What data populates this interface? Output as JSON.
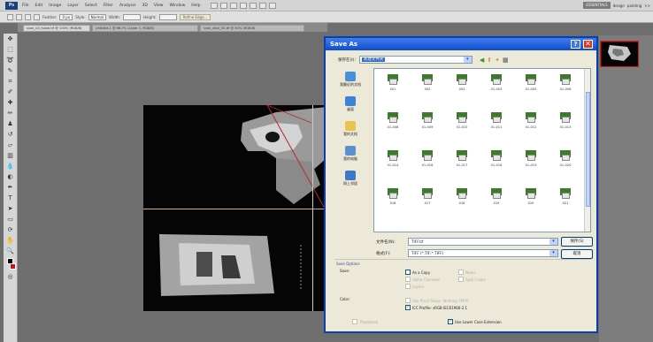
{
  "app": {
    "logo": "Ps",
    "menu": [
      "File",
      "Edit",
      "Image",
      "Layer",
      "Select",
      "Filter",
      "Analysis",
      "3D",
      "View",
      "Window",
      "Help"
    ],
    "workspace": {
      "active": "ESSENTIALS",
      "links": [
        "design",
        "painting",
        ">>"
      ]
    }
  },
  "options_bar": {
    "feather_label": "Feather:",
    "feather_value": "0 px",
    "style_label": "Style:",
    "style_value": "Normal",
    "width_label": "Width:",
    "height_label": "Height:",
    "refine_edge": "Refine Edge..."
  },
  "doc_tabs": [
    "scan_v3_fused.tif @ 100% (RGB/8)",
    "Untitled-1 @ 66.7% (Layer 1, RGB/8)",
    "scan_slice_02.tif @ 50% (RGB/8)"
  ],
  "dialog": {
    "title": "Save As",
    "save_in_label": "保存在(I):",
    "save_in_value": "新建文件夹",
    "places": [
      {
        "label": "我最近的文档",
        "color": "#4a8fd9"
      },
      {
        "label": "桌面",
        "color": "#3d83d6"
      },
      {
        "label": "我的文档",
        "color": "#e8c352"
      },
      {
        "label": "我的电脑",
        "color": "#5c8fcf"
      },
      {
        "label": "网上邻居",
        "color": "#3e78c8"
      }
    ],
    "files": [
      "001",
      "002",
      "003",
      "01-003",
      "01-005",
      "01-006",
      "01-008",
      "01-009",
      "01-010",
      "01-011",
      "01-012",
      "01-013",
      "01-014",
      "01-016",
      "01-017",
      "01-018",
      "01-019",
      "01-020",
      "016",
      "017",
      "018",
      "019",
      "020",
      "021"
    ],
    "filename_label": "文件名(N):",
    "filename_value": "TIFF.tif",
    "format_label": "格式(F):",
    "format_value": "TIFF (*.TIF;*.TIFF)",
    "save_button": "保存(S)",
    "cancel_button": "取消",
    "save_options_title": "Save Options",
    "save_label": "Save:",
    "color_label": "Color:",
    "options": {
      "as_a_copy": "As a Copy",
      "notes": "Notes",
      "alpha_channels": "Alpha Channels",
      "spot_colors": "Spot Colors",
      "layers": "Layers",
      "use_proof_setup": "Use Proof Setup:  Working CMYK",
      "icc_profile": "ICC Profile:  sRGB IEC61966-2.1",
      "thumbnail": "Thumbnail",
      "use_lower_case": "Use Lower Case Extension"
    }
  }
}
